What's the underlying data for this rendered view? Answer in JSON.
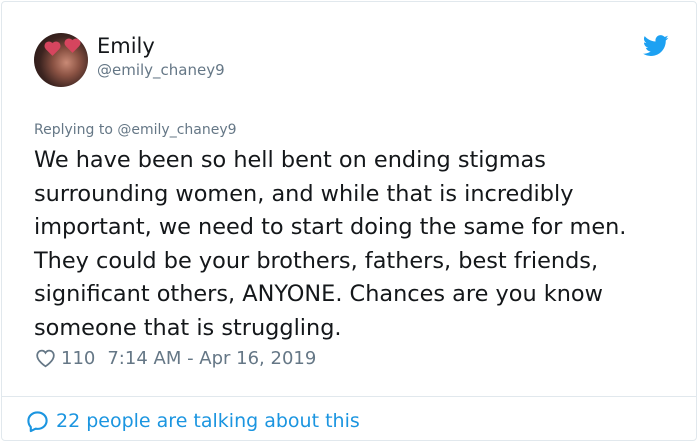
{
  "author": {
    "display_name": "Emily",
    "handle": "@emily_chaney9",
    "avatar_icon": "profile-photo"
  },
  "reply": {
    "prefix": "Replying to",
    "mention": "@emily_chaney9"
  },
  "tweet": {
    "lines": [
      "We have been so hell bent on ending stigmas",
      "surrounding women, and while that is incredibly",
      "important, we need to start doing the same for men.",
      "They could be your brothers, fathers, best friends,",
      "significant others, ANYONE. Chances are you know",
      "someone that is struggling."
    ]
  },
  "meta": {
    "likes": "110",
    "timestamp": "7:14 AM - Apr 16, 2019",
    "like_icon": "heart-outline-icon"
  },
  "footer": {
    "talking_text": "22 people are talking about this",
    "talking_icon": "speech-bubble-icon"
  },
  "colors": {
    "brand_blue": "#1da1f2",
    "link_blue": "#1b95e0",
    "secondary_text": "#657786",
    "primary_text": "#14171a",
    "border": "#e1e8ed"
  }
}
